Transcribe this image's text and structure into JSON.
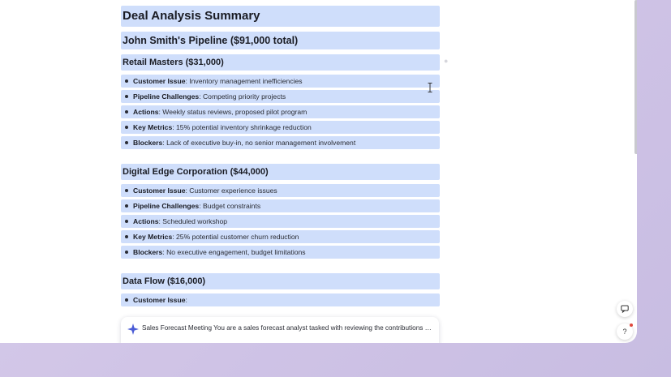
{
  "doc": {
    "title": "Deal Analysis Summary",
    "pipeline_heading": "John Smith's Pipeline ($91,000 total)",
    "sections": [
      {
        "heading": "Retail Masters ($31,000)",
        "items": [
          {
            "label": "Customer Issue",
            "sep": ": ",
            "text": "Inventory management inefficiencies"
          },
          {
            "label": "Pipeline Challenges",
            "sep": ": ",
            "text": "Competing priority projects"
          },
          {
            "label": "Actions",
            "sep": ": ",
            "text": "Weekly status reviews, proposed pilot program"
          },
          {
            "label": "Key Metrics",
            "sep": ": ",
            "text": "15% potential inventory shrinkage reduction"
          },
          {
            "label": "Blockers",
            "sep": ": ",
            "text": "Lack of executive buy-in, no senior management involvement"
          }
        ]
      },
      {
        "heading": "Digital Edge Corporation ($44,000)",
        "items": [
          {
            "label": "Customer Issue",
            "sep": ": ",
            "text": "Customer experience issues"
          },
          {
            "label": "Pipeline Challenges",
            "sep": ": ",
            "text": "Budget constraints"
          },
          {
            "label": "Actions",
            "sep": ": ",
            "text": "Scheduled workshop"
          },
          {
            "label": "Key Metrics",
            "sep": ": ",
            "text": "25% potential customer churn reduction"
          },
          {
            "label": "Blockers",
            "sep": ": ",
            "text": "No executive engagement, budget limitations"
          }
        ]
      },
      {
        "heading": "Data Flow ($16,000)",
        "items": [
          {
            "label": "Customer Issue",
            "sep": ":",
            "text": ""
          }
        ]
      }
    ]
  },
  "prompt_card": {
    "text": "Sales Forecast Meeting You are a sales forecast analyst tasked with reviewing the contributions of ..."
  },
  "fabs": {
    "chat_icon": "chat-bubble-icon",
    "help_glyph": "?"
  },
  "colors": {
    "highlight": "#cfdefb",
    "background": "#d8cdea",
    "accent_spark": "#4a5bd6",
    "notify_dot": "#e0483c"
  }
}
